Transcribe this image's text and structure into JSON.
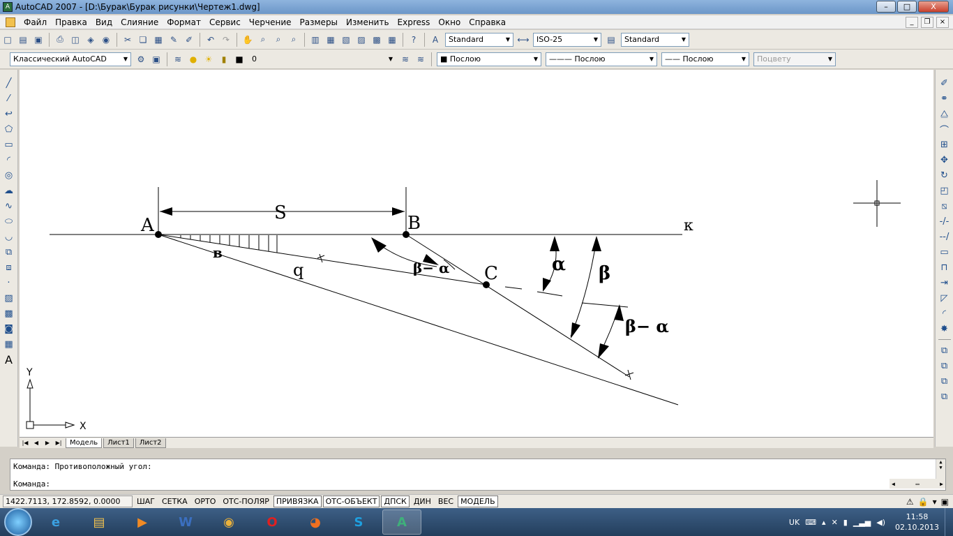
{
  "window": {
    "title": "AutoCAD 2007 - [D:\\Бурак\\Бурак рисунки\\Чертеж1.dwg]",
    "buttons": [
      "–",
      "□",
      "X"
    ]
  },
  "menu": {
    "items": [
      "Файл",
      "Правка",
      "Вид",
      "Слияние",
      "Формат",
      "Сервис",
      "Черчение",
      "Размеры",
      "Изменить",
      "Express",
      "Окно",
      "Справка"
    ]
  },
  "toolbar1": {
    "text_style": "Standard",
    "dim_style": "ISO-25",
    "table_style": "Standard"
  },
  "toolbar2": {
    "workspace": "Классический AutoCAD",
    "layer": "0",
    "color": "Послою",
    "linetype": "Послою",
    "lineweight": "Послою",
    "plotstyle": "Поцвету"
  },
  "drawing": {
    "labels": {
      "A": "A",
      "B": "B",
      "C": "C",
      "S": "S",
      "K": "к",
      "b_small": "в",
      "q": "q",
      "alpha": "α",
      "beta": "β",
      "beta_minus_alpha_1": "β− α",
      "beta_minus_alpha_2": "β− α"
    },
    "ucs": {
      "x": "X",
      "y": "Y"
    }
  },
  "tabs": [
    "Модель",
    "Лист1",
    "Лист2"
  ],
  "command": {
    "history": "Команда: Противоположный угол:",
    "prompt": "Команда:"
  },
  "status": {
    "coords": "1422.7113, 172.8592, 0.0000",
    "toggles": [
      {
        "label": "ШАГ",
        "on": false
      },
      {
        "label": "СЕТКА",
        "on": false
      },
      {
        "label": "ОРТО",
        "on": false
      },
      {
        "label": "ОТС-ПОЛЯР",
        "on": false
      },
      {
        "label": "ПРИВЯЗКА",
        "on": true
      },
      {
        "label": "ОТС-ОБЪЕКТ",
        "on": true
      },
      {
        "label": "ДПСК",
        "on": true
      },
      {
        "label": "ДИН",
        "on": false
      },
      {
        "label": "ВЕС",
        "on": false
      },
      {
        "label": "МОДЕЛЬ",
        "on": true
      }
    ]
  },
  "taskbar": {
    "lang": "UK",
    "time": "11:58",
    "date": "02.10.2013"
  },
  "colors": {
    "canvas": "#ffffff",
    "ink": "#000000"
  }
}
